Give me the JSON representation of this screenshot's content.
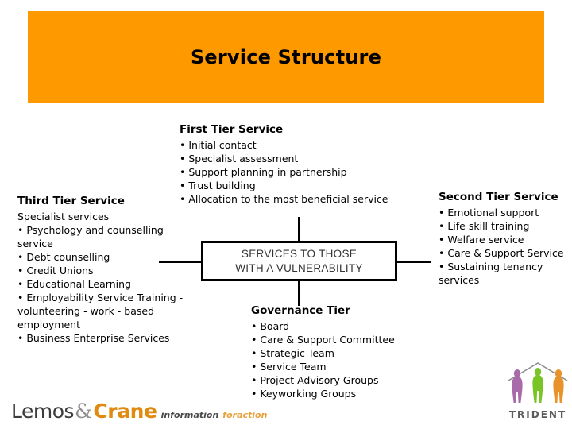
{
  "slide": {
    "title": "Service Structure",
    "banner_color": "#ff9900"
  },
  "center_node": {
    "name": "services-to-those-with-a-vulnerability",
    "line1": "SERVICES TO THOSE",
    "line2": "WITH A VULNERABILITY"
  },
  "first_tier": {
    "heading": "First Tier Service",
    "items": [
      "• Initial contact",
      "• Specialist assessment",
      "• Support planning in partnership",
      "• Trust building",
      "• Allocation to the most beneficial service"
    ]
  },
  "second_tier": {
    "heading": "Second Tier Service",
    "items": [
      "• Emotional support",
      "• Life skill training",
      "• Welfare service",
      "• Care & Support Service",
      "• Sustaining tenancy services"
    ]
  },
  "third_tier": {
    "heading": "Third Tier Service",
    "items": [
      "Specialist services",
      "• Psychology and counselling service",
      "• Debt counselling",
      "• Credit Unions",
      "• Educational Learning",
      "• Employability Service  Training - volunteering - work - based employment",
      "• Business Enterprise Services"
    ]
  },
  "governance_tier": {
    "heading": "Governance Tier",
    "items": [
      "• Board",
      "• Care & Support Committee",
      "• Strategic Team",
      "• Service Team",
      "• Project Advisory Groups",
      "• Keyworking Groups"
    ]
  },
  "lemos_crane_logo": {
    "part1": "Lemos",
    "ampersand": "&",
    "part2": "Crane",
    "tagline_dark": "information",
    "tagline_orange": "foraction"
  },
  "trident_logo": {
    "wordmark": "TRIDENT",
    "figure_colors": [
      "#a86aa8",
      "#7ac526",
      "#e8922a"
    ],
    "arch_color": "#8a8a8a"
  }
}
